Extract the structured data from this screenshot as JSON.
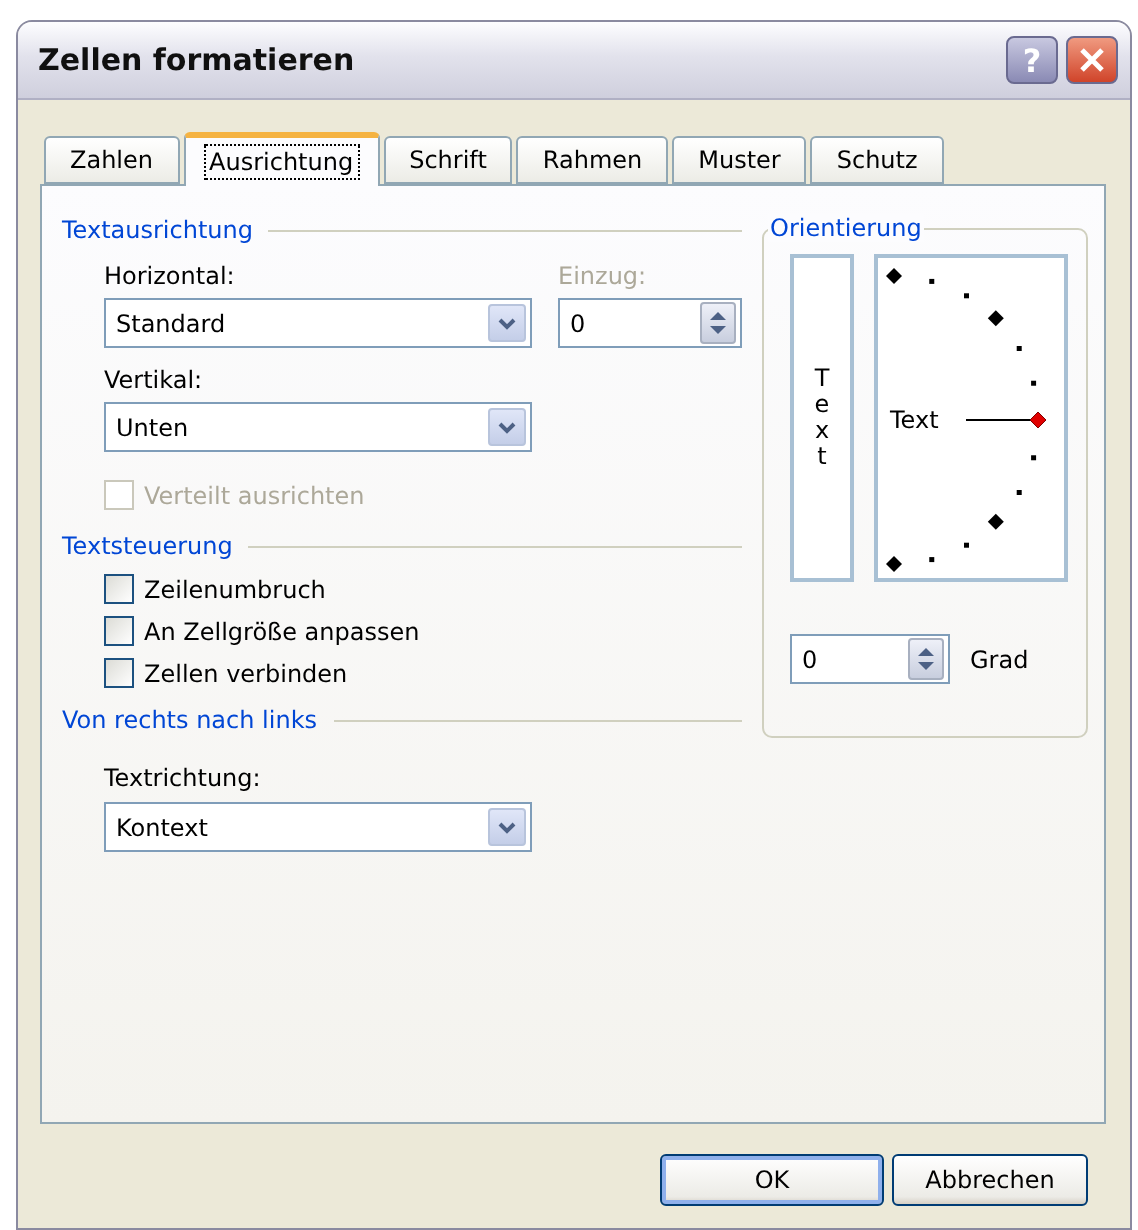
{
  "window": {
    "title": "Zellen formatieren",
    "help": "?"
  },
  "tabs": [
    {
      "label": "Zahlen",
      "selected": false
    },
    {
      "label": "Ausrichtung",
      "selected": true
    },
    {
      "label": "Schrift",
      "selected": false
    },
    {
      "label": "Rahmen",
      "selected": false
    },
    {
      "label": "Muster",
      "selected": false
    },
    {
      "label": "Schutz",
      "selected": false
    }
  ],
  "text_alignment": {
    "title": "Textausrichtung",
    "horizontal": {
      "label": "Horizontal:",
      "value": "Standard"
    },
    "indent": {
      "label": "Einzug:",
      "disabled": true,
      "value": "0"
    },
    "vertical": {
      "label": "Vertikal:",
      "value": "Unten"
    },
    "distributed": {
      "label": "Verteilt ausrichten",
      "checked": false,
      "disabled": true
    }
  },
  "text_control": {
    "title": "Textsteuerung",
    "options": [
      {
        "label": "Zeilenumbruch",
        "checked": false
      },
      {
        "label": "An Zellgröße anpassen",
        "checked": false
      },
      {
        "label": "Zellen verbinden",
        "checked": false
      }
    ]
  },
  "right_to_left": {
    "title": "Von rechts nach links",
    "direction": {
      "label": "Textrichtung:",
      "value": "Kontext"
    }
  },
  "orientation": {
    "title": "Orientierung",
    "vertical_text": "Text",
    "dial_text": "Text",
    "degrees": {
      "value": "0",
      "label": "Grad"
    }
  },
  "buttons": [
    {
      "label": "OK",
      "default": true
    },
    {
      "label": "Abbrechen",
      "default": false
    }
  ]
}
